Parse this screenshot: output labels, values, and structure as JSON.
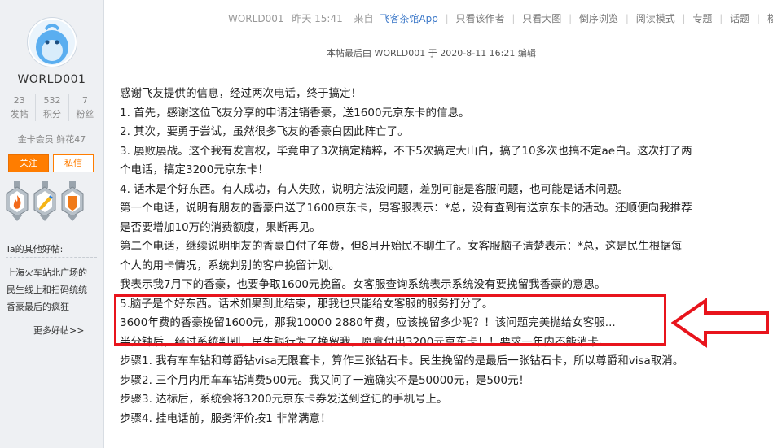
{
  "user": {
    "name": "WORLD001",
    "stats": [
      {
        "value": "23",
        "label": "发帖"
      },
      {
        "value": "532",
        "label": "积分"
      },
      {
        "value": "7",
        "label": "粉丝"
      }
    ],
    "member_info": "金卡会员 鲜花47",
    "follow_label": "关注",
    "message_label": "私信"
  },
  "others": {
    "title": "Ta的其他好帖:",
    "items": [
      "上海火车站北广场的",
      "民生线上和扫码统统",
      "香豪最后的疯狂"
    ],
    "more_label": "更多好帖>>"
  },
  "meta": {
    "author": "WORLD001",
    "time": "昨天 15:41",
    "from_label": "来自",
    "app_name": "飞客茶馆App",
    "links": [
      "只看该作者",
      "只看大图",
      "倒序浏览",
      "阅读模式",
      "专题",
      "话题",
      "楼主"
    ]
  },
  "edit_note": "本帖最后由 WORLD001 于 2020-8-11 16:21 编辑",
  "post": {
    "lines": [
      "感谢飞友提供的信息，经过两次电话，终于搞定！",
      "1. 首先，感谢这位飞友分享的申请注销香豪，送1600元京东卡的信息。",
      "2. 其次，要勇于尝试，虽然很多飞友的香豪白因此阵亡了。",
      "3. 屡败屡战。这个我有发言权，毕竟申了3次搞定精粹，不下5次搞定大山白，搞了10多次也搞不定ae白。这次打了两",
      "个电话，搞定3200元京东卡！",
      "4. 话术是个好东西。有人成功，有人失败，说明方法没问题，差别可能是客服问题，也可能是话术问题。",
      "第一个电话，说明有朋友的香豪白送了1600京东卡，男客服表示：*总，没有查到有送京东卡的活动。还顺便向我推荐",
      "是否要增加10万的消费额度，果断再见。",
      "第二个电话，继续说明朋友的香豪白付了年费，但8月开始民不聊生了。女客服脑子清楚表示：*总，这是民生根据每",
      "个人的用卡情况，系统判别的客户挽留计划。",
      "我表示我7月下的香豪，也要争取1600元挽留。女客服查询系统表示系统没有要挽留我香豪的意思。",
      "5.脑子是个好东西。话术如果到此结束，那我也只能给女客服的服务打分了。",
      "3600年费的香豪挽留1600元，那我10000 2880年费，应该挽留多少呢？！该问题完美抛给女客服...",
      "半分钟后，经过系统判别，民生银行为了挽留我，愿意付出3200元京东卡！！要求一年内不能消卡。",
      "步骤1. 我有车车钻和尊爵钻visa无限套卡，算作三张钻石卡。民生挽留的是最后一张钻石卡，所以尊爵和visa取消。",
      "步骤2. 三个月内用车车钻消费500元。我又问了一遍确实不是50000元，是500元！",
      "步骤3. 达标后，系统会将3200元京东卡券发送到登记的手机号上。",
      "步骤4. 挂电话前，服务评价按1 非常满意！"
    ]
  },
  "colors": {
    "accent_orange": "#ff7d00",
    "annotation_red": "#e8141c",
    "app_link_blue": "#3c78c8"
  }
}
